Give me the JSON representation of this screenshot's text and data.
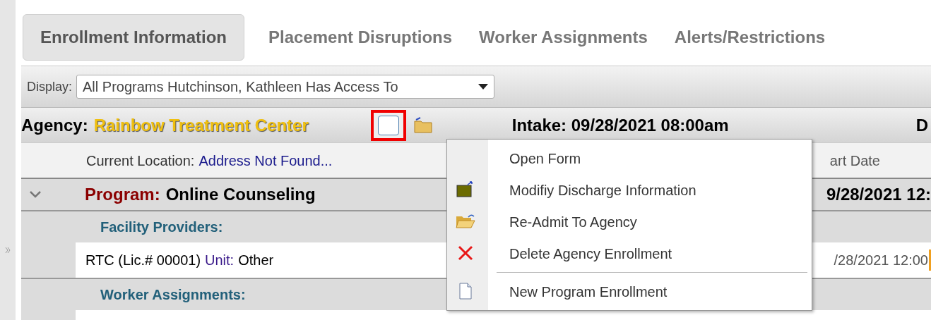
{
  "tabs": [
    {
      "label": "Enrollment Information",
      "selected": true
    },
    {
      "label": "Placement Disruptions",
      "selected": false
    },
    {
      "label": "Worker Assignments",
      "selected": false
    },
    {
      "label": "Alerts/Restrictions",
      "selected": false
    }
  ],
  "display": {
    "label": "Display:",
    "value": "All Programs Hutchinson, Kathleen Has Access To"
  },
  "agency": {
    "label": "Agency:",
    "name": "Rainbow Treatment Center",
    "intake": "Intake: 09/28/2021 08:00am",
    "column_cut": "D"
  },
  "location": {
    "label": "Current Location:",
    "value": "Address Not Found...",
    "column_cut": "art Date"
  },
  "program": {
    "label": "Program:",
    "name": "Online Counseling",
    "expanded": true,
    "date": "9/28/2021 12:"
  },
  "sections": [
    {
      "title": "Facility Providers:",
      "rows": [
        {
          "text": "RTC (Lic.# 00001)",
          "unit_label": "Unit:",
          "unit": "Other",
          "date": "/28/2021 12:00"
        }
      ]
    },
    {
      "title": "Worker Assignments:"
    }
  ],
  "context_menu": {
    "items": [
      {
        "label": "Open Form",
        "kind": "none",
        "separator_before": false
      },
      {
        "label": "Modifiy Discharge Information",
        "kind": "folder-closed",
        "separator_before": false
      },
      {
        "label": "Re-Admit To Agency",
        "kind": "folder-open",
        "separator_before": false
      },
      {
        "label": "Delete Agency Enrollment",
        "kind": "delete",
        "separator_before": false
      },
      {
        "label": "New Program Enrollment",
        "kind": "page",
        "separator_before": true
      }
    ]
  }
}
